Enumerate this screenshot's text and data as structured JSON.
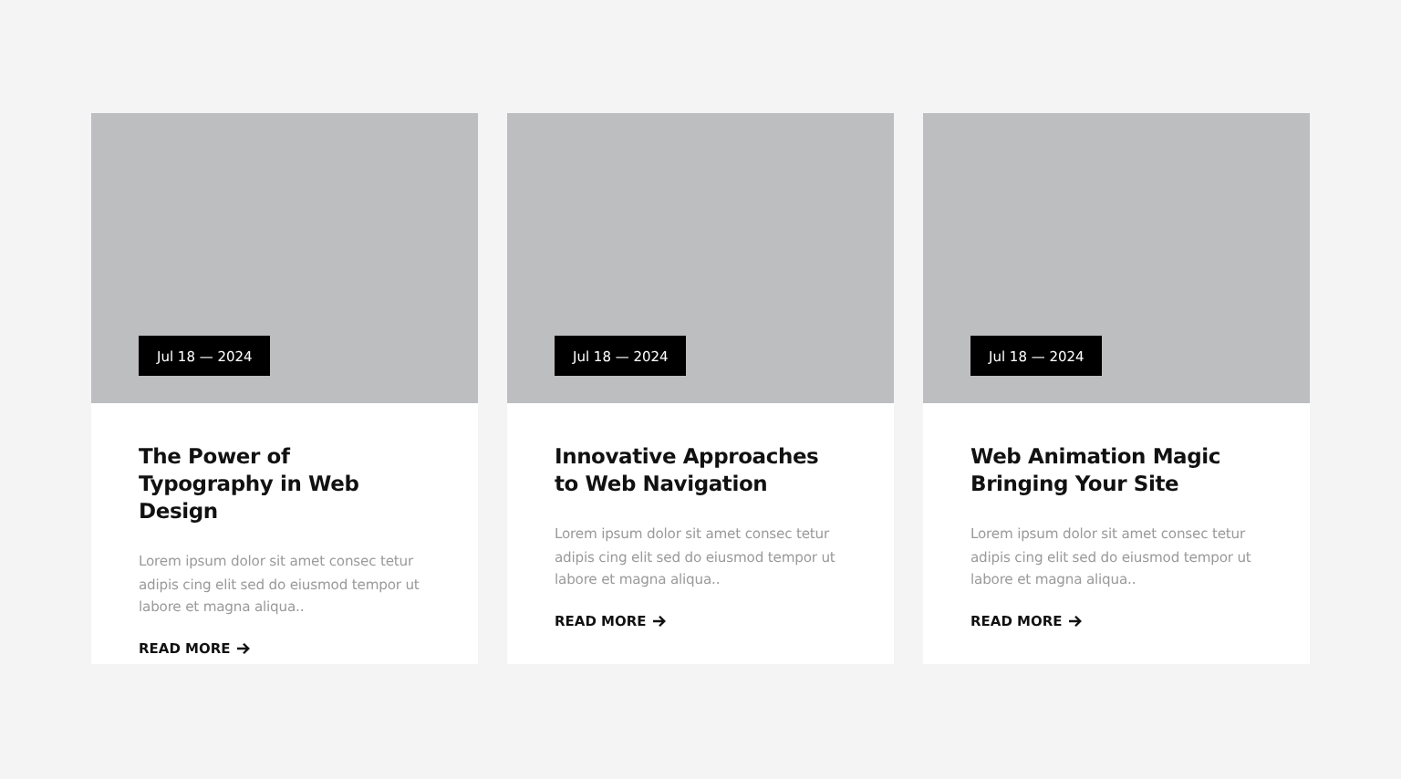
{
  "posts": [
    {
      "date": "Jul 18 — 2024",
      "title": "The Power of Typography in Web Design",
      "excerpt": "Lorem ipsum dolor sit amet consec tetur adipis cing elit sed do eiusmod tempor ut labore et magna aliqua..",
      "link": "READ MORE"
    },
    {
      "date": "Jul 18 — 2024",
      "title": "Innovative Approaches to Web Navigation",
      "excerpt": "Lorem ipsum dolor sit amet consec tetur adipis cing elit sed do eiusmod tempor ut labore et magna aliqua..",
      "link": "READ MORE"
    },
    {
      "date": "Jul 18 — 2024",
      "title": "Web Animation Magic Bringing Your Site",
      "excerpt": "Lorem ipsum dolor sit amet consec tetur adipis cing elit sed do eiusmod tempor ut labore et magna aliqua..",
      "link": "READ MORE"
    }
  ]
}
